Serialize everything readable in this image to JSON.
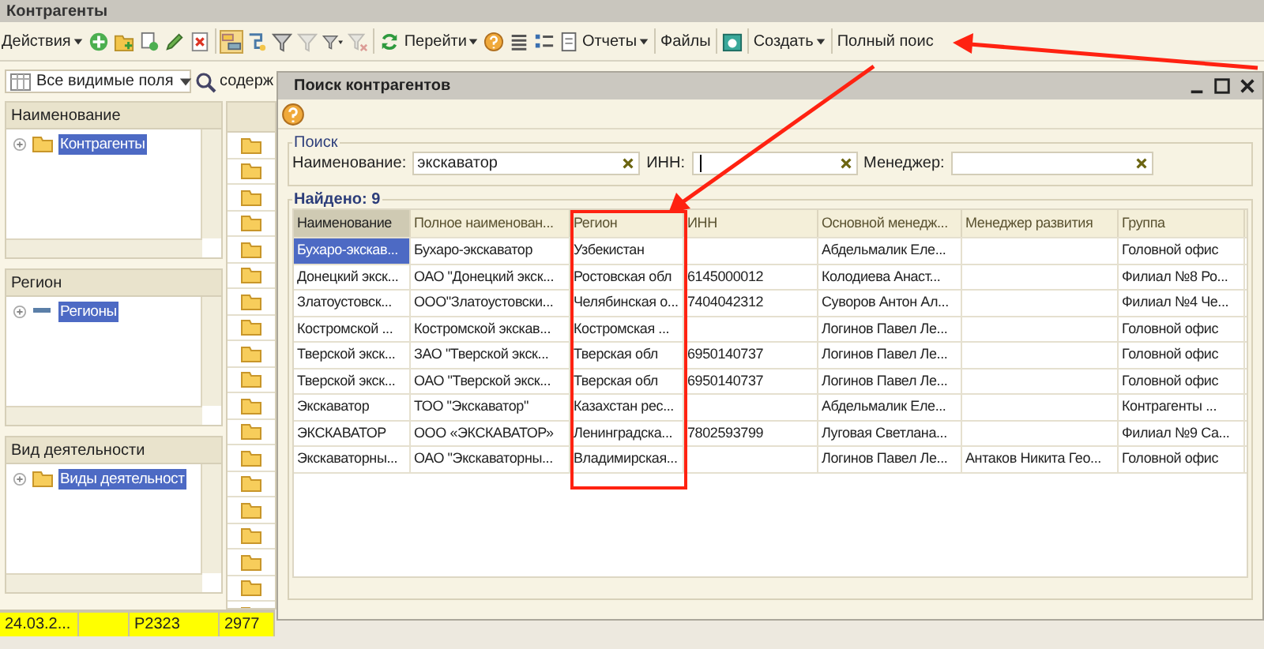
{
  "window": {
    "title": "Контрагенты"
  },
  "toolbar": {
    "actions_menu": "Действия",
    "goto_menu": "Перейти",
    "reports_menu": "Отчеты",
    "files": "Файлы",
    "create_menu": "Создать",
    "full_search": "Полный поис"
  },
  "filter": {
    "field": "Все видимые поля",
    "condition": "содерж"
  },
  "panels": [
    {
      "title": "Наименование",
      "item": {
        "label": "Контрагенты",
        "kind": "folder",
        "selected": true
      }
    },
    {
      "title": "Регион",
      "item": {
        "label": "Регионы",
        "kind": "dash",
        "selected": true
      }
    },
    {
      "title": "Вид деятельности",
      "item": {
        "label": "Виды деятельност",
        "kind": "folder",
        "selected": true
      }
    }
  ],
  "bottom_row": {
    "selected": true,
    "column_1": "24.03.2...",
    "column_3": "P2323",
    "column_4": "2977"
  },
  "dialog": {
    "title": "Поиск контрагентов",
    "search_group": {
      "title": "Поиск",
      "fields": [
        {
          "label": "Наименование:",
          "value": "экскаватор",
          "focused": false
        },
        {
          "label": "ИНН:",
          "focused": true
        },
        {
          "label": "Менеджер:",
          "focused": false
        }
      ]
    },
    "results": {
      "title": "Найдено: 9",
      "columns": [
        {
          "label": "Наименование",
          "sorted": true
        },
        {
          "label": "Полное наименован...",
          "sorted": false
        },
        {
          "label": "Регион",
          "sorted": false
        },
        {
          "label": "ИНН",
          "sorted": false
        },
        {
          "label": "Основной менедж...",
          "sorted": false
        },
        {
          "label": "Менеджер развития",
          "sorted": false
        },
        {
          "label": "Группа",
          "sorted": false
        }
      ],
      "rows": [
        {
          "selected": true,
          "cells": [
            "Бухаро-экскав...",
            "Бухаро-экскаватор",
            "Узбекистан",
            null,
            "Абдельмалик Еле...",
            null,
            "Головной офис"
          ]
        },
        {
          "selected": false,
          "cells": [
            "Донецкий экск...",
            "ОАО \"Донецкий экск...",
            "Ростовская обл",
            "6145000012",
            "Колодиева Анаст...",
            null,
            "Филиал №8 Ро..."
          ]
        },
        {
          "selected": false,
          "cells": [
            "Златоустовск...",
            "ООО\"Златоустовски...",
            "Челябинская о...",
            "7404042312",
            "Суворов Антон Ал...",
            null,
            "Филиал №4 Че..."
          ]
        },
        {
          "selected": false,
          "cells": [
            "Костромской ...",
            "Костромской экскав...",
            "Костромская ...",
            null,
            "Логинов Павел Ле...",
            null,
            "Головной офис"
          ]
        },
        {
          "selected": false,
          "cells": [
            "Тверской экск...",
            "ЗАО \"Тверской экск...",
            "Тверская обл",
            "6950140737",
            "Логинов Павел Ле...",
            null,
            "Головной офис"
          ]
        },
        {
          "selected": false,
          "cells": [
            "Тверской экск...",
            "ОАО \"Тверской экск...",
            "Тверская обл",
            "6950140737",
            "Логинов Павел Ле...",
            null,
            "Головной офис"
          ]
        },
        {
          "selected": false,
          "cells": [
            "Экскаватор",
            "ТОО \"Экскаватор\"",
            "Казахстан рес...",
            null,
            "Абдельмалик Еле...",
            null,
            "Контрагенты ..."
          ]
        },
        {
          "selected": false,
          "cells": [
            "ЭКСКАВАТОР",
            "ООО «ЭКСКАВАТОР»",
            "Ленинградска...",
            "7802593799",
            "Луговая Светлана...",
            null,
            "Филиал №9 Са..."
          ]
        },
        {
          "selected": false,
          "cells": [
            "Экскаваторны...",
            "ОАО \"Экскаваторны...",
            "Владимирская...",
            null,
            "Логинов Павел Ле...",
            "Антаков Никита Гео...",
            "Головной офис"
          ]
        }
      ]
    }
  }
}
